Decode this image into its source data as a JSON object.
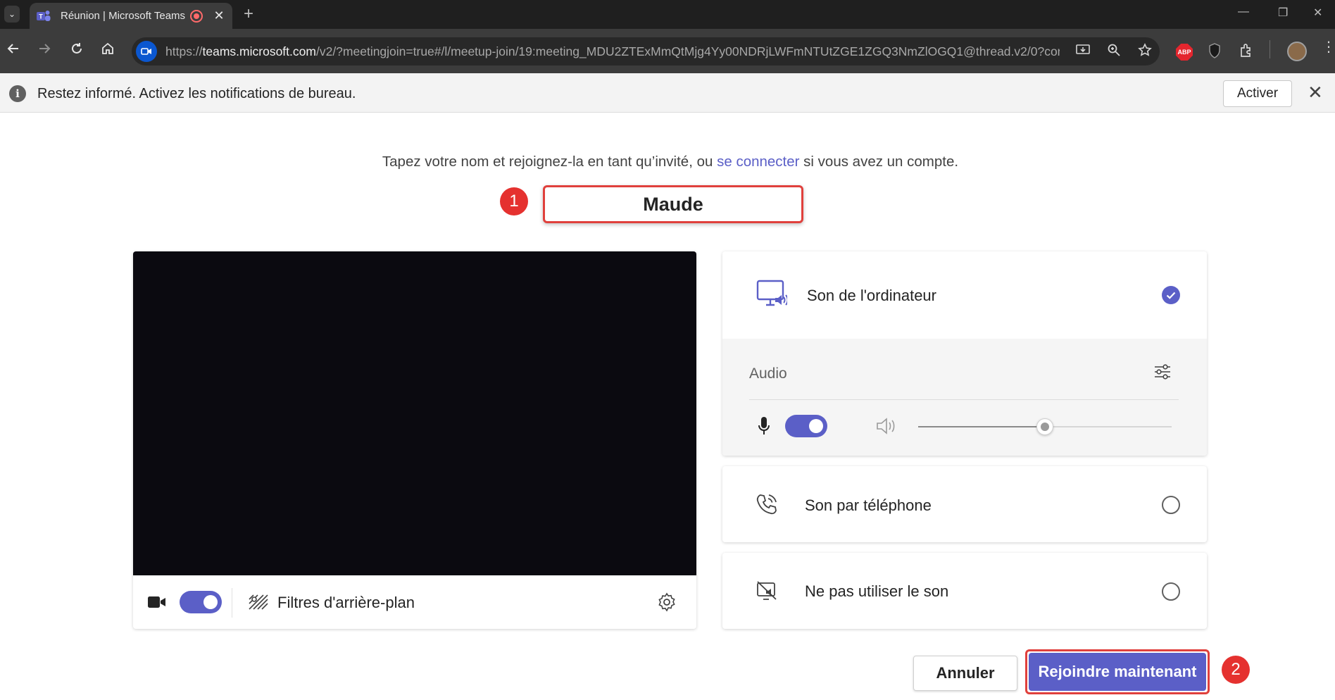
{
  "browser": {
    "tab": {
      "title": "Réunion | Microsoft Teams",
      "close_glyph": "✕",
      "new_tab_glyph": "+"
    },
    "window_controls": {
      "minimize": "—",
      "restore": "❐",
      "close": "✕"
    },
    "address_bar": {
      "url_prefix": "https://",
      "url_host": "teams.microsoft.com",
      "url_path": "/v2/?meetingjoin=true#/l/meetup-join/19:meeting_MDU2ZTExMmQtMjg4Yy00NDRjLWFmNTUtZGE1ZGQ3NmZlOGQ1@thread.v2/0?con..."
    },
    "extensions": {
      "abp": "ABP"
    }
  },
  "notification": {
    "icon_glyph": "i",
    "text": "Restez informé. Activez les notifications de bureau.",
    "action_label": "Activer",
    "close_glyph": "✕"
  },
  "join": {
    "prompt_before": "Tapez votre nom et rejoignez-la en tant qu’invité, ou ",
    "prompt_link": "se connecter",
    "prompt_after": " si vous avez un compte.",
    "name_value": "Maude",
    "step1": "1",
    "step2": "2"
  },
  "video": {
    "camera_on": true,
    "background_filters_label": "Filtres d'arrière-plan"
  },
  "audio_options": {
    "computer": {
      "label": "Son de l'ordinateur",
      "selected": true
    },
    "audio_section_title": "Audio",
    "mic_on": true,
    "speaker_volume_percent": 50,
    "phone": {
      "label": "Son par téléphone",
      "selected": false
    },
    "none": {
      "label": "Ne pas utiliser le son",
      "selected": false
    }
  },
  "actions": {
    "cancel_label": "Annuler",
    "join_label": "Rejoindre maintenant"
  },
  "colors": {
    "accent": "#5b5fc7",
    "highlight_red": "#e0403c",
    "browser_bg": "#1f1f1f"
  }
}
